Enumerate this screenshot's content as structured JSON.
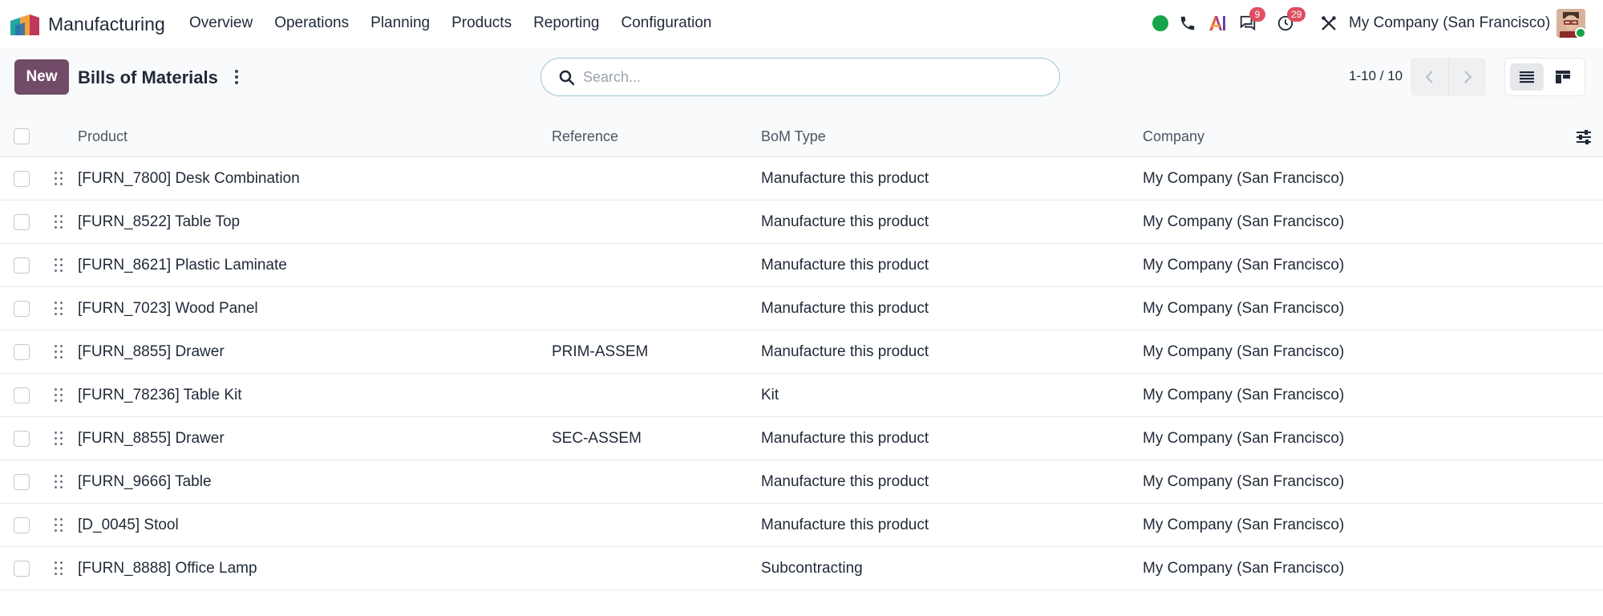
{
  "app": {
    "name": "Manufacturing",
    "menu": [
      "Overview",
      "Operations",
      "Planning",
      "Products",
      "Reporting",
      "Configuration"
    ],
    "company": "My Company (San Francisco)",
    "badges": {
      "messages": "9",
      "activities": "29"
    },
    "icons": [
      "status-online-icon",
      "phone-icon",
      "ai-icon",
      "messages-icon",
      "activity-clock-icon",
      "debug-tools-icon"
    ]
  },
  "control": {
    "new_label": "New",
    "title": "Bills of Materials",
    "search_placeholder": "Search...",
    "pager": "1-10 / 10"
  },
  "table": {
    "headers": {
      "product": "Product",
      "reference": "Reference",
      "bom_type": "BoM Type",
      "company": "Company"
    },
    "rows": [
      {
        "product": "[FURN_7800] Desk Combination",
        "reference": "",
        "bom_type": "Manufacture this product",
        "company": "My Company (San Francisco)"
      },
      {
        "product": "[FURN_8522] Table Top",
        "reference": "",
        "bom_type": "Manufacture this product",
        "company": "My Company (San Francisco)"
      },
      {
        "product": "[FURN_8621] Plastic Laminate",
        "reference": "",
        "bom_type": "Manufacture this product",
        "company": "My Company (San Francisco)"
      },
      {
        "product": "[FURN_7023] Wood Panel",
        "reference": "",
        "bom_type": "Manufacture this product",
        "company": "My Company (San Francisco)"
      },
      {
        "product": "[FURN_8855] Drawer",
        "reference": "PRIM-ASSEM",
        "bom_type": "Manufacture this product",
        "company": "My Company (San Francisco)"
      },
      {
        "product": "[FURN_78236] Table Kit",
        "reference": "",
        "bom_type": "Kit",
        "company": "My Company (San Francisco)"
      },
      {
        "product": "[FURN_8855] Drawer",
        "reference": "SEC-ASSEM",
        "bom_type": "Manufacture this product",
        "company": "My Company (San Francisco)"
      },
      {
        "product": "[FURN_9666] Table",
        "reference": "",
        "bom_type": "Manufacture this product",
        "company": "My Company (San Francisco)"
      },
      {
        "product": "[D_0045] Stool",
        "reference": "",
        "bom_type": "Manufacture this product",
        "company": "My Company (San Francisco)"
      },
      {
        "product": "[FURN_8888] Office Lamp",
        "reference": "",
        "bom_type": "Subcontracting",
        "company": "My Company (San Francisco)"
      }
    ]
  },
  "colors": {
    "brand": "#714b67",
    "online": "#17a34a",
    "badge": "#e04f5f",
    "search_border": "#9ec7cf"
  }
}
